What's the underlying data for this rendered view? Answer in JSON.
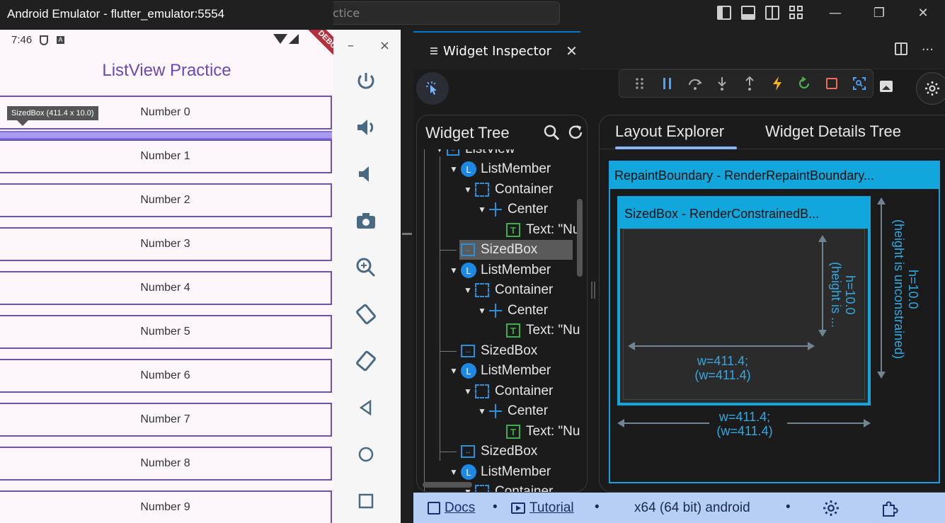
{
  "vscode": {
    "search_text": "ctice",
    "window_buttons": [
      "—",
      "❐",
      "✕"
    ]
  },
  "emulator": {
    "title": "Android Emulator - flutter_emulator:5554",
    "status_time": "7:46",
    "debug_ribbon": "DEBUG",
    "app_title": "ListView Practice",
    "tooltip": "SizedBox (411.4 x 10.0)",
    "items": [
      "Number 0",
      "Number 1",
      "Number 2",
      "Number 3",
      "Number 4",
      "Number 5",
      "Number 6",
      "Number 7",
      "Number 8",
      "Number 9"
    ],
    "side_minimize": "–",
    "side_close": "×"
  },
  "editor": {
    "tab_label": "Widget Inspector",
    "tab_close": "✕",
    "more": "···"
  },
  "widget_tree": {
    "title": "Widget Tree",
    "rows": [
      {
        "label": "ListView"
      },
      {
        "label": "ListMember"
      },
      {
        "label": "Container"
      },
      {
        "label": "Center"
      },
      {
        "label": "Text: \"Nu"
      },
      {
        "label": "SizedBox"
      },
      {
        "label": "ListMember"
      },
      {
        "label": "Container"
      },
      {
        "label": "Center"
      },
      {
        "label": "Text: \"Nu"
      },
      {
        "label": "SizedBox"
      },
      {
        "label": "ListMember"
      },
      {
        "label": "Container"
      },
      {
        "label": "Center"
      },
      {
        "label": "Text: \"Nu"
      },
      {
        "label": "SizedBox"
      },
      {
        "label": "ListMember"
      },
      {
        "label": "Container"
      }
    ]
  },
  "layout_explorer": {
    "tab_active": "Layout Explorer",
    "tab_other": "Widget Details Tree",
    "outer_title": "RepaintBoundary - RenderRepaintBoundary...",
    "inner_title": "SizedBox - RenderConstrainedB...",
    "inner_h": "h=10.0",
    "inner_h_note": "(height is ...",
    "inner_w": "w=411.4;",
    "inner_w_note": "(w=411.4)",
    "outer_h": "h=10.0",
    "outer_h_note": "(height is unconstrained)",
    "outer_w": "w=411.4;",
    "outer_w_note": "(w=411.4)"
  },
  "status": {
    "docs": "Docs",
    "tutorial": "Tutorial",
    "device": "x64 (64 bit) android",
    "sep": "•"
  },
  "colors": {
    "accent": "#11a6dc",
    "list_border": "#6e50bd",
    "status_bg": "#b8cff5"
  }
}
